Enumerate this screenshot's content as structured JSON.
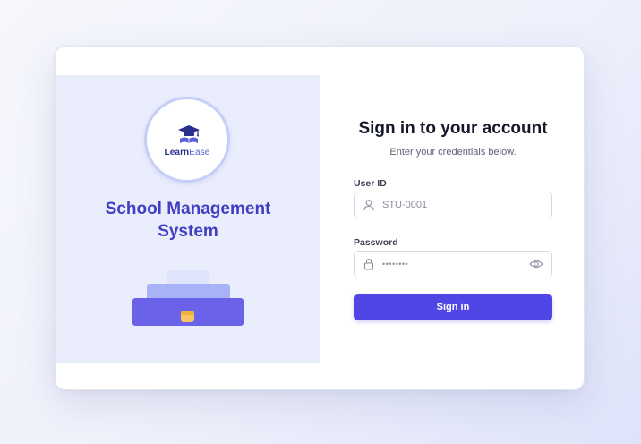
{
  "brand": {
    "logo_word_1": "Learn",
    "logo_word_2": "Ease",
    "system_title_line1": "School Management",
    "system_title_line2": "System",
    "logo_icon": "graduation-cap-book-icon"
  },
  "form": {
    "title": "Sign in to your account",
    "subtitle": "Enter your credentials below.",
    "user_id": {
      "label": "User ID",
      "placeholder": "STU-0001",
      "icon": "user-icon"
    },
    "password": {
      "label": "Password",
      "masked_value": "••••••••",
      "icon": "lock-icon",
      "toggle_icon": "eye-icon"
    },
    "submit_label": "Sign in"
  },
  "colors": {
    "accent": "#4f46e5",
    "title_purple": "#3f3ec4",
    "panel_bg": "#eaedfc"
  }
}
